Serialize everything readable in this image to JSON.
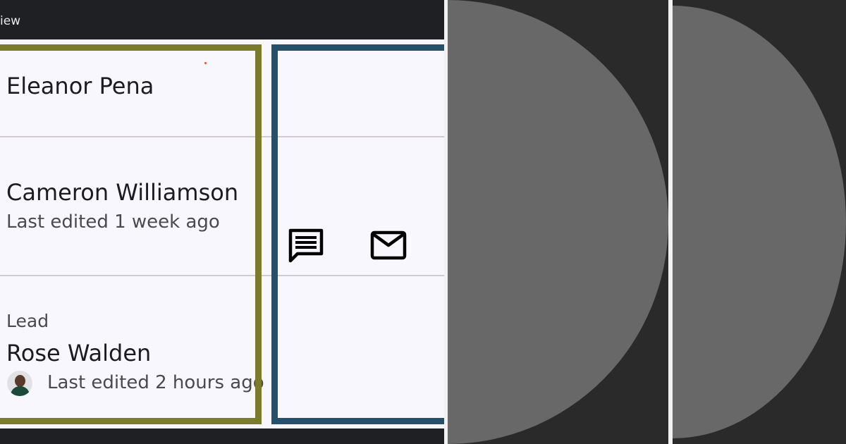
{
  "topbar": {
    "title": "iew"
  },
  "rows": [
    {
      "name": "Eleanor Pena"
    },
    {
      "name": "Cameron Williamson",
      "subtitle": "Last edited 1 week ago"
    },
    {
      "overline": "Lead",
      "name": "Rose Walden",
      "subtitle": "Last edited 2 hours ago"
    }
  ],
  "actions": {
    "chat_icon": "chat-icon",
    "mail_icon": "mail-icon"
  },
  "colors": {
    "frame_olive": "#7a7c2a",
    "frame_blue": "#23506a",
    "surface": "#f8f7fd",
    "placeholder": "#686868"
  }
}
